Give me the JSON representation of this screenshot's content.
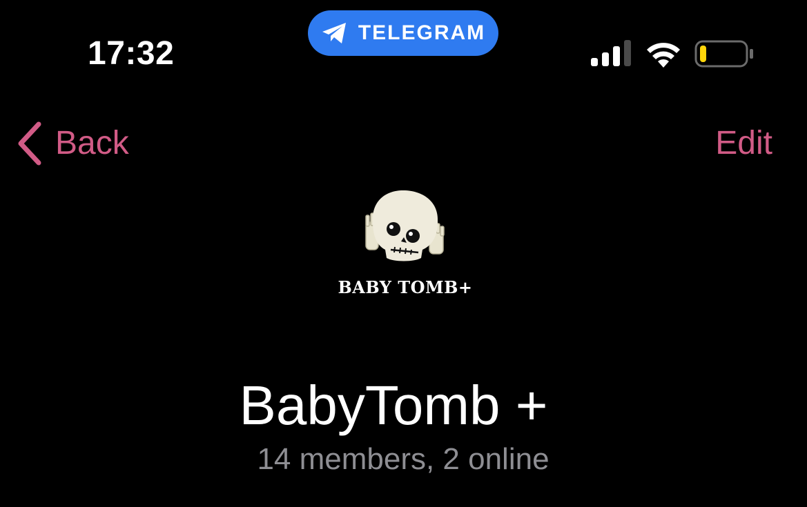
{
  "status_bar": {
    "time": "17:32",
    "app_pill": {
      "label": "TELEGRAM",
      "icon": "telegram-plane-icon",
      "color": "#2f7bf0"
    },
    "signal_icon": "cellular-signal-icon",
    "wifi_icon": "wifi-icon",
    "battery_icon": "battery-icon",
    "battery_level": 0.15,
    "battery_color": "#ffd60a"
  },
  "nav": {
    "back_label": "Back",
    "edit_label": "Edit",
    "accent_color": "#d15b86"
  },
  "group": {
    "avatar_logo_text": "BABY TOMB+",
    "name": "BabyTomb +",
    "subtitle": "14 members, 2 online"
  }
}
